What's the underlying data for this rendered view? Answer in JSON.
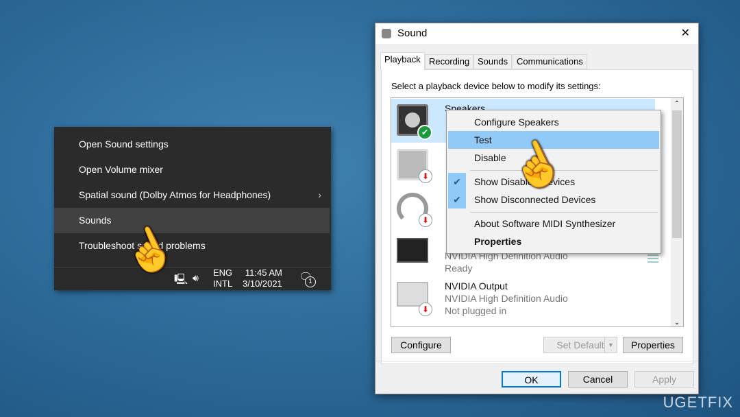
{
  "tray_menu": {
    "items": [
      {
        "label": "Open Sound settings"
      },
      {
        "label": "Open Volume mixer"
      },
      {
        "label": "Spatial sound (Dolby Atmos for Headphones)",
        "submenu": true
      },
      {
        "label": "Sounds",
        "selected": true
      },
      {
        "label": "Troubleshoot sound problems"
      }
    ]
  },
  "taskbar": {
    "lang_top": "ENG",
    "lang_bottom": "INTL",
    "time": "11:45 AM",
    "date": "3/10/2021",
    "notification_count": "1"
  },
  "dialog": {
    "title": "Sound",
    "close": "✕",
    "tabs": [
      {
        "label": "Playback",
        "active": true
      },
      {
        "label": "Recording"
      },
      {
        "label": "Sounds"
      },
      {
        "label": "Communications"
      }
    ],
    "instruction": "Select a playback device below to modify its settings:",
    "devices": [
      {
        "name": "Speakers",
        "driver": "",
        "status": "",
        "icon": "speaker-icon",
        "badge": "default-check"
      },
      {
        "name": "",
        "driver": "",
        "status": "",
        "icon": "speaker-icon",
        "badge": "disconnected"
      },
      {
        "name": "",
        "driver": "",
        "status": "",
        "icon": "headphones-icon",
        "badge": "disconnected"
      },
      {
        "name": "",
        "driver": "NVIDIA High Definition Audio",
        "status": "Ready",
        "icon": "monitor-icon",
        "badge": ""
      },
      {
        "name": "NVIDIA Output",
        "driver": "NVIDIA High Definition Audio",
        "status": "Not plugged in",
        "icon": "monitor-icon",
        "badge": "disconnected"
      }
    ],
    "buttons": {
      "configure": "Configure",
      "set_default": "Set Default",
      "properties": "Properties",
      "ok": "OK",
      "cancel": "Cancel",
      "apply": "Apply"
    }
  },
  "context_menu": {
    "items": [
      {
        "label": "Configure Speakers"
      },
      {
        "label": "Test",
        "highlighted": true
      },
      {
        "label": "Disable"
      },
      {
        "label": "Show Disabled Devices",
        "checked": true
      },
      {
        "label": "Show Disconnected Devices",
        "checked": true
      },
      {
        "label": "About Software MIDI Synthesizer"
      },
      {
        "label": "Properties",
        "bold": true
      }
    ]
  },
  "watermark": "UGETFIX"
}
